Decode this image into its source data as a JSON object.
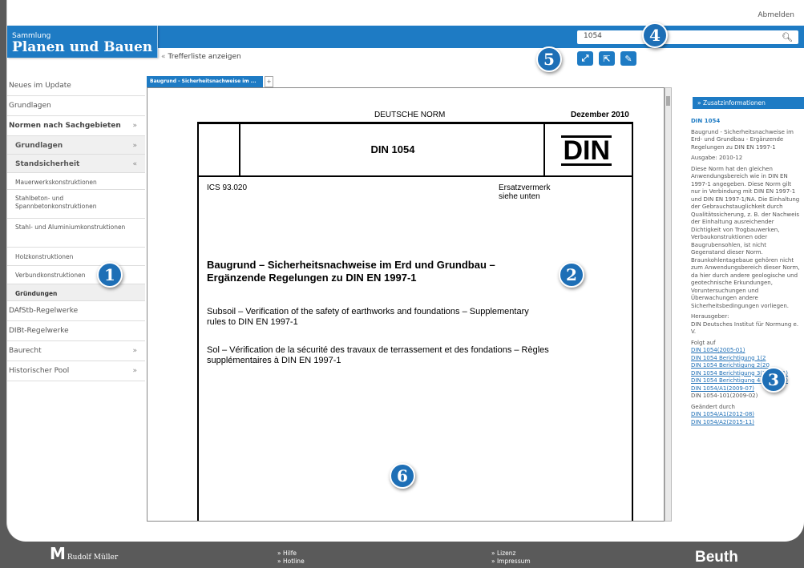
{
  "header": {
    "logout": "Abmelden",
    "brand_small": "Sammlung",
    "brand_big": "Planen und Bauen",
    "search_value": "1054",
    "back_label": "Trefferliste anzeigen"
  },
  "callouts": [
    "1",
    "2",
    "3",
    "4",
    "5",
    "6"
  ],
  "toolbar": {
    "icons": [
      "expand-icon",
      "external-link-icon",
      "edit-icon"
    ]
  },
  "sidebar": {
    "items": [
      {
        "label": "Neues im Update"
      },
      {
        "label": "Grundlagen"
      },
      {
        "label": "Normen nach Sachgebieten",
        "arrow": "»"
      },
      {
        "label": "Grundlagen",
        "arrow": "»"
      },
      {
        "label": "Standsicherheit",
        "arrow": "«"
      },
      {
        "label": "Mauerwerkskonstruktionen"
      },
      {
        "label": "Stahlbeton- und Spannbetonkonstruktionen"
      },
      {
        "label": "Stahl- und Aluminiumkonstruktionen"
      },
      {
        "label": "Holzkonstruktionen"
      },
      {
        "label": "Verbundkonstruktionen"
      },
      {
        "label": "Gründungen"
      },
      {
        "label": "DAfStb-Regelwerke"
      },
      {
        "label": "DIBt-Regelwerke"
      },
      {
        "label": "Baurecht",
        "arrow": "»"
      },
      {
        "label": "Historischer Pool",
        "arrow": "»"
      }
    ]
  },
  "tab": {
    "label": "Baugrund - Sicherheitsnachweise im ...",
    "plus": "+"
  },
  "document": {
    "norm_label": "DEUTSCHE NORM",
    "date": "Dezember 2010",
    "din_title": "DIN 1054",
    "din_logo": "DIN",
    "ics": "ICS 93.020",
    "ersatz": "Ersatzvermerk siehe unten",
    "title_de": "Baugrund – Sicherheitsnachweise im Erd und Grundbau – Ergänzende Regelungen zu DIN EN 1997-1",
    "title_en": "Subsoil – Verification of the safety of earthworks and foundations – Supplementary rules to DIN EN 1997-1",
    "title_fr": "Sol – Vérification de la sécurité des travaux de terrassement et des fondations – Règles supplémentaires à DIN EN 1997-1"
  },
  "info": {
    "heading": "Zusatzinformationen",
    "din": "DIN 1054",
    "desc": "Baugrund - Sicherheitsnachweise im Erd- und Grundbau - Ergänzende Regelungen zu DIN EN 1997-1",
    "ausgabe": "Ausgabe: 2010-12",
    "body": "Diese Norm hat den gleichen Anwendungsbereich wie in DIN EN 1997-1 angegeben. Diese Norm gilt nur in Verbindung mit DIN EN 1997-1 und DIN EN 1997-1/NA. Die Einhaltung der Gebrauchstauglichkeit durch Qualitätssicherung, z. B. der Nachweis der Einhaltung ausreichender Dichtigkeit von Trogbauwerken, Verbaukonstruktionen oder Baugrubensohlen, ist nicht Gegenstand dieser Norm. Braunkohlentagebaue gehören nicht zum Anwendungsbereich dieser Norm, da hier durch andere geologische und geotechnische Erkundungen, Voruntersuchungen und Überwachungen andere Sicherheitsbedingungen vorliegen.",
    "herausgeber_label": "Herausgeber:",
    "herausgeber": "DIN Deutsches Institut für Normung e. V.",
    "folgt_label": "Folgt auf",
    "folgt": [
      "DIN 1054(2005-01)",
      "DIN 1054 Berichtigung 1(2",
      "DIN 1054 Berichtigung 2(20",
      "DIN 1054 Berichtigung 3(2008-01)",
      "DIN 1054 Berichtigung 4(2008-10)",
      "DIN 1054/A1(2009-07)"
    ],
    "folgt_plain": "DIN 1054-101(2009-02)",
    "geaendert_label": "Geändert durch",
    "geaendert": [
      "DIN 1054/A1(2012-08)",
      "DIN 1054/A2(2015-11)"
    ]
  },
  "footer": {
    "brand_left": "Rudolf Müller",
    "hilfe": "» Hilfe",
    "hotline": "» Hotline",
    "lizenz": "» Lizenz",
    "impressum": "» Impressum",
    "beuth": "Beuth"
  }
}
